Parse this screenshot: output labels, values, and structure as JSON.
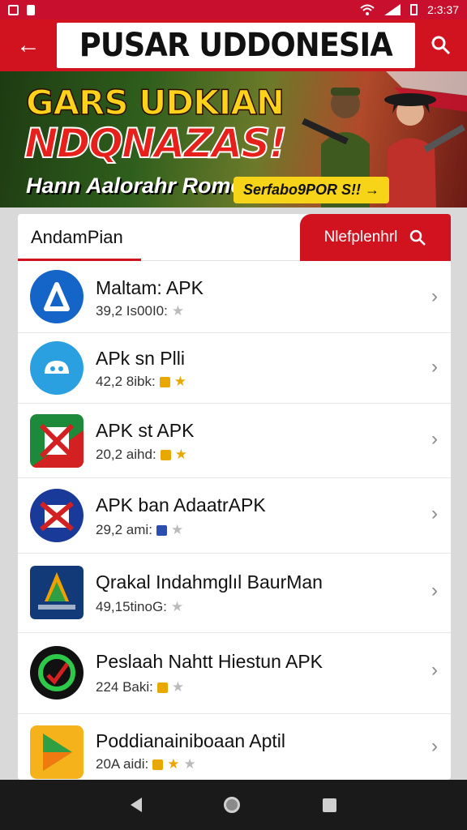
{
  "status_bar": {
    "time": "2:3:37"
  },
  "app_bar": {
    "title": "PUSAR UDDONESIA"
  },
  "banner": {
    "headline_1": "GARS UDKIAN",
    "headline_2": "NDQNAZAS!",
    "subtitle": "Hann Aalorahr Rome",
    "pill": "Serfabo9POR S!! →"
  },
  "tabs": {
    "left_label": "AndamPian",
    "right_label": "Nlefplenhrl"
  },
  "apps": [
    {
      "name": "Maltam: APK",
      "meta": "39,2 Is00I0:",
      "icon": "triangle-a-icon"
    },
    {
      "name": "APk sn Plli",
      "meta": "42,2 8ibk:",
      "icon": "cloud-face-icon"
    },
    {
      "name": "APK st APK",
      "meta": "20,2 aihd:",
      "icon": "red-box-icon"
    },
    {
      "name": "APK ban AdaatrAPK",
      "meta": "29,2 ami:",
      "icon": "blue-bag-icon"
    },
    {
      "name": "Qrakal Indahmglıl BaurMan",
      "meta": "49,15tinoG:",
      "icon": "star-logo-icon"
    },
    {
      "name": "Peslaah Nahtt Hiestun APK",
      "meta": "224 Baki:",
      "icon": "green-ring-icon"
    },
    {
      "name": "Poddianainiboaan Aptil",
      "meta": "20A aidi:",
      "icon": "play-triangle-icon"
    }
  ],
  "colors": {
    "primary": "#d0131f",
    "accent": "#f7d417"
  }
}
